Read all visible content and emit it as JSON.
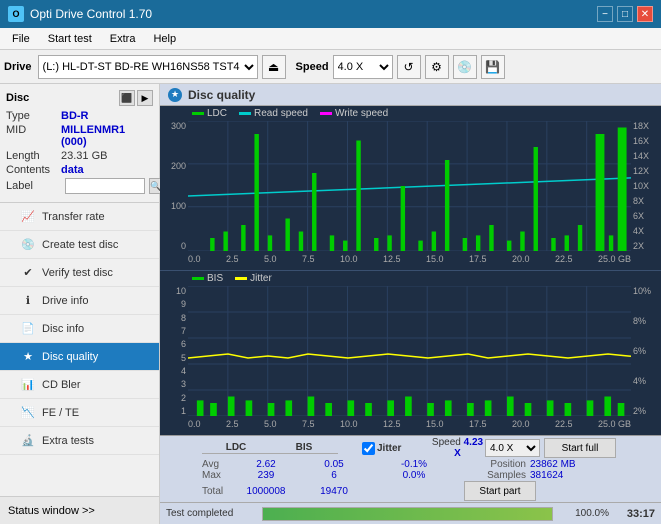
{
  "titlebar": {
    "title": "Opti Drive Control 1.70",
    "icon": "O",
    "minimize": "−",
    "maximize": "□",
    "close": "✕"
  },
  "menubar": {
    "items": [
      "File",
      "Start test",
      "Extra",
      "Help"
    ]
  },
  "toolbar": {
    "drive_label": "Drive",
    "drive_value": "(L:)  HL-DT-ST BD-RE  WH16NS58 TST4",
    "speed_label": "Speed",
    "speed_value": "4.0 X"
  },
  "disc": {
    "title": "Disc",
    "type_label": "Type",
    "type_value": "BD-R",
    "mid_label": "MID",
    "mid_value": "MILLENMR1 (000)",
    "length_label": "Length",
    "length_value": "23.31 GB",
    "contents_label": "Contents",
    "contents_value": "data",
    "label_label": "Label",
    "label_placeholder": ""
  },
  "nav": {
    "items": [
      {
        "label": "Transfer rate",
        "icon": "📈",
        "active": false
      },
      {
        "label": "Create test disc",
        "icon": "💿",
        "active": false
      },
      {
        "label": "Verify test disc",
        "icon": "✔",
        "active": false
      },
      {
        "label": "Drive info",
        "icon": "ℹ",
        "active": false
      },
      {
        "label": "Disc info",
        "icon": "📄",
        "active": false
      },
      {
        "label": "Disc quality",
        "icon": "★",
        "active": true
      },
      {
        "label": "CD Bler",
        "icon": "📊",
        "active": false
      },
      {
        "label": "FE / TE",
        "icon": "📉",
        "active": false
      },
      {
        "label": "Extra tests",
        "icon": "🔬",
        "active": false
      }
    ]
  },
  "status_window": "Status window >>",
  "disc_quality": {
    "title": "Disc quality",
    "chart1": {
      "legend": [
        {
          "label": "LDC",
          "color": "#00cc00"
        },
        {
          "label": "Read speed",
          "color": "#00cccc"
        },
        {
          "label": "Write speed",
          "color": "#ff00ff"
        }
      ],
      "y_left": [
        "300",
        "200",
        "100",
        "0"
      ],
      "y_right": [
        "18X",
        "16X",
        "14X",
        "12X",
        "10X",
        "8X",
        "6X",
        "4X",
        "2X"
      ],
      "x_axis": [
        "0.0",
        "2.5",
        "5.0",
        "7.5",
        "10.0",
        "12.5",
        "15.0",
        "17.5",
        "20.0",
        "22.5",
        "25.0 GB"
      ]
    },
    "chart2": {
      "legend": [
        {
          "label": "BIS",
          "color": "#00cc00"
        },
        {
          "label": "Jitter",
          "color": "#ffff00"
        }
      ],
      "y_left": [
        "10",
        "9",
        "8",
        "7",
        "6",
        "5",
        "4",
        "3",
        "2",
        "1"
      ],
      "y_right": [
        "10%",
        "8%",
        "6%",
        "4%",
        "2%"
      ],
      "x_axis": [
        "0.0",
        "2.5",
        "5.0",
        "7.5",
        "10.0",
        "12.5",
        "15.0",
        "17.5",
        "20.0",
        "22.5",
        "25.0 GB"
      ]
    },
    "stats": {
      "headers": [
        "LDC",
        "BIS",
        "",
        "Jitter",
        "Speed"
      ],
      "avg_label": "Avg",
      "avg_ldc": "2.62",
      "avg_bis": "0.05",
      "avg_jitter": "-0.1%",
      "max_label": "Max",
      "max_ldc": "239",
      "max_bis": "6",
      "max_jitter": "0.0%",
      "total_label": "Total",
      "total_ldc": "1000008",
      "total_bis": "19470",
      "jitter_checked": true,
      "jitter_label": "Jitter",
      "speed_label": "Speed",
      "speed_value": "4.23 X",
      "speed_select": "4.0 X",
      "position_label": "Position",
      "position_value": "23862 MB",
      "samples_label": "Samples",
      "samples_value": "381624",
      "start_full_label": "Start full",
      "start_part_label": "Start part"
    }
  },
  "progress": {
    "status_text": "Test completed",
    "percent": "100.0%",
    "time": "33:17"
  }
}
